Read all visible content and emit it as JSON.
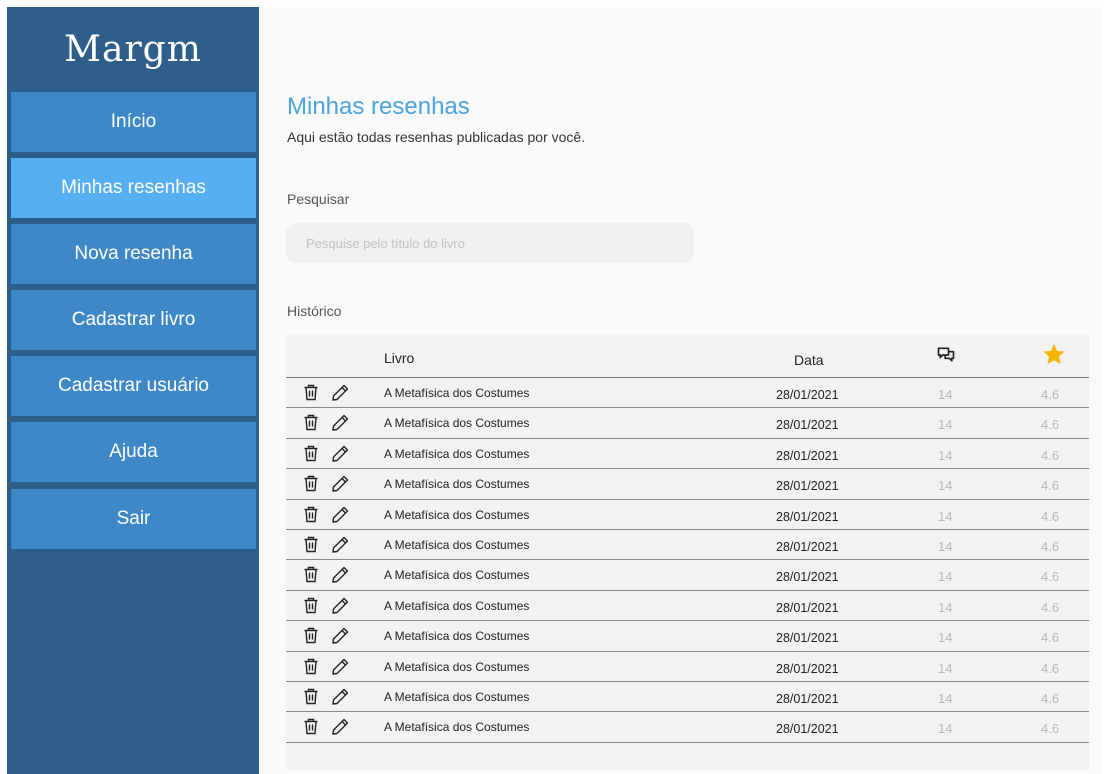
{
  "app": {
    "logo": "Margm"
  },
  "sidebar": {
    "items": [
      {
        "label": "Início",
        "active": false
      },
      {
        "label": "Minhas resenhas",
        "active": true
      },
      {
        "label": "Nova resenha",
        "active": false
      },
      {
        "label": "Cadastrar livro",
        "active": false
      },
      {
        "label": "Cadastrar usuário",
        "active": false
      },
      {
        "label": "Ajuda",
        "active": false
      },
      {
        "label": "Sair",
        "active": false
      }
    ]
  },
  "page": {
    "title": "Minhas resenhas",
    "subtitle": "Aqui estão todas resenhas publicadas por você."
  },
  "search": {
    "label": "Pesquisar",
    "placeholder": "Pesquise pelo título do livro",
    "value": ""
  },
  "history": {
    "label": "Histórico",
    "columns": {
      "livro": "Livro",
      "data": "Data",
      "comments_icon": "comments-icon",
      "rating_icon": "star-icon"
    },
    "rows": [
      {
        "livro": "A Metafísica dos Costumes",
        "data": "28/01/2021",
        "comments": "14",
        "rating": "4.6"
      },
      {
        "livro": "A Metafísica dos Costumes",
        "data": "28/01/2021",
        "comments": "14",
        "rating": "4.6"
      },
      {
        "livro": "A Metafísica dos Costumes",
        "data": "28/01/2021",
        "comments": "14",
        "rating": "4.6"
      },
      {
        "livro": "A Metafísica dos Costumes",
        "data": "28/01/2021",
        "comments": "14",
        "rating": "4.6"
      },
      {
        "livro": "A Metafísica dos Costumes",
        "data": "28/01/2021",
        "comments": "14",
        "rating": "4.6"
      },
      {
        "livro": "A Metafísica dos Costumes",
        "data": "28/01/2021",
        "comments": "14",
        "rating": "4.6"
      },
      {
        "livro": "A Metafísica dos Costumes",
        "data": "28/01/2021",
        "comments": "14",
        "rating": "4.6"
      },
      {
        "livro": "A Metafísica dos Costumes",
        "data": "28/01/2021",
        "comments": "14",
        "rating": "4.6"
      },
      {
        "livro": "A Metafísica dos Costumes",
        "data": "28/01/2021",
        "comments": "14",
        "rating": "4.6"
      },
      {
        "livro": "A Metafísica dos Costumes",
        "data": "28/01/2021",
        "comments": "14",
        "rating": "4.6"
      },
      {
        "livro": "A Metafísica dos Costumes",
        "data": "28/01/2021",
        "comments": "14",
        "rating": "4.6"
      },
      {
        "livro": "A Metafísica dos Costumes",
        "data": "28/01/2021",
        "comments": "14",
        "rating": "4.6"
      }
    ]
  },
  "colors": {
    "sidebar_bg": "#2e5f8a",
    "nav_item": "#3f88c8",
    "nav_item_active": "#55aeef",
    "title_blue": "#4aa3df",
    "star": "#f5b400"
  }
}
